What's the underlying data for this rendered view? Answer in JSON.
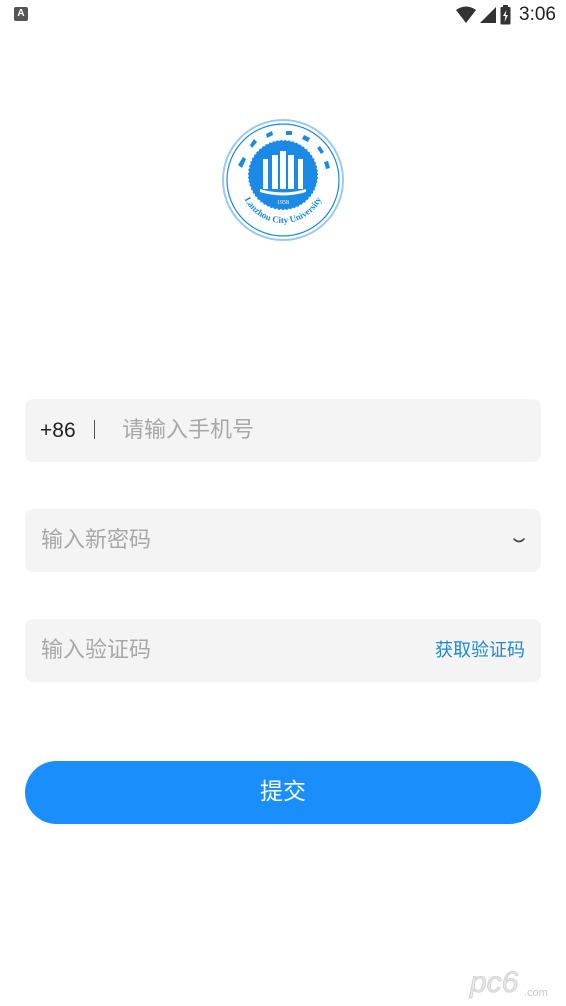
{
  "status_bar": {
    "notification_icon": "A",
    "time": "3:06",
    "icons": [
      "wifi-icon",
      "cell-signal-icon",
      "battery-icon"
    ]
  },
  "logo": {
    "name": "university-seal-logo",
    "arc_text": "Lanzhou City University",
    "year": "1958",
    "colors": {
      "primary": "#1a8ae6",
      "light": "#9cc9f0"
    }
  },
  "form": {
    "phone": {
      "country_code": "+86",
      "placeholder": "请输入手机号",
      "value": ""
    },
    "password": {
      "placeholder": "输入新密码",
      "value": "",
      "toggle_icon": "eye-closed-icon"
    },
    "code": {
      "placeholder": "输入验证码",
      "value": "",
      "get_code_label": "获取验证码"
    },
    "submit_label": "提交"
  },
  "watermark": {
    "text": "pc6",
    "suffix": ".com"
  },
  "colors": {
    "accent": "#1a8ffb",
    "link": "#1b8ad1",
    "field_bg": "#f4f4f4",
    "placeholder": "#a8a8a8"
  }
}
